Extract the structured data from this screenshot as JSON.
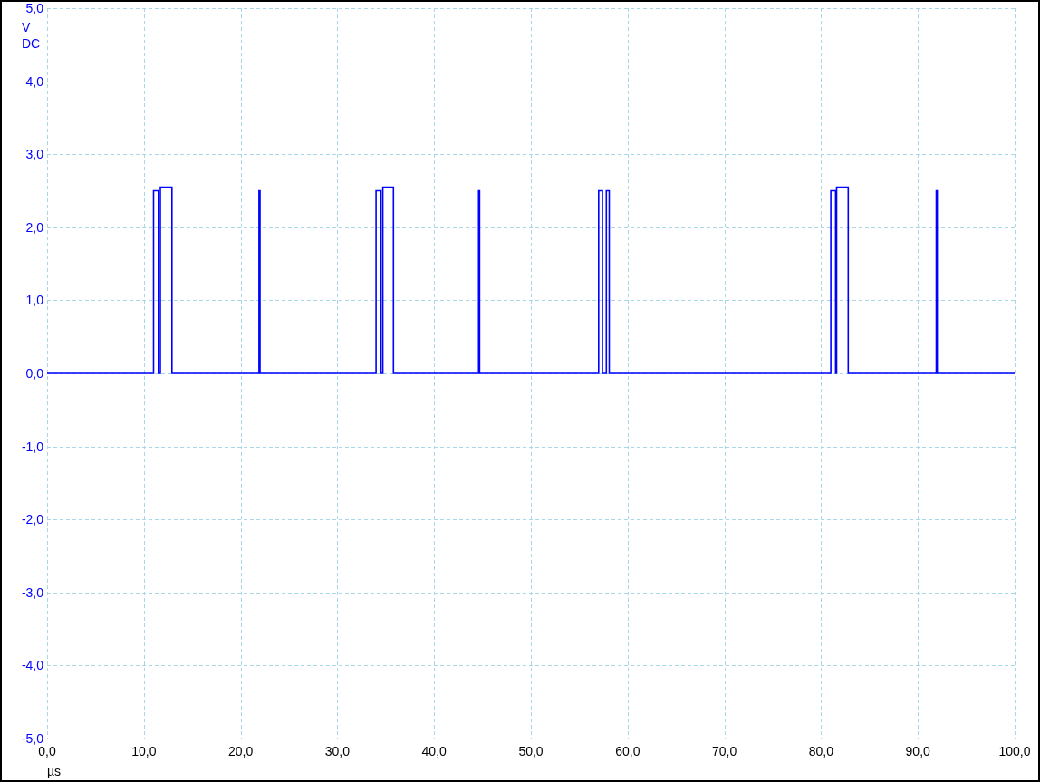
{
  "scope": {
    "coupling": "DC",
    "chart_data": {
      "type": "line",
      "grid": true,
      "xlabel": "µs",
      "ylabel": "V",
      "xlim": [
        0,
        100
      ],
      "ylim": [
        -5,
        5
      ],
      "xticks": [
        {
          "value": 0,
          "label": "0,0"
        },
        {
          "value": 10,
          "label": "10,0"
        },
        {
          "value": 20,
          "label": "20,0"
        },
        {
          "value": 30,
          "label": "30,0"
        },
        {
          "value": 40,
          "label": "40,0"
        },
        {
          "value": 50,
          "label": "50,0"
        },
        {
          "value": 60,
          "label": "60,0"
        },
        {
          "value": 70,
          "label": "70,0"
        },
        {
          "value": 80,
          "label": "80,0"
        },
        {
          "value": 90,
          "label": "90,0"
        },
        {
          "value": 100,
          "label": "100,0"
        }
      ],
      "yticks": [
        {
          "value": 5,
          "label": "5,0"
        },
        {
          "value": 4,
          "label": "4,0"
        },
        {
          "value": 3,
          "label": "3,0"
        },
        {
          "value": 2,
          "label": "2,0"
        },
        {
          "value": 1,
          "label": "1,0"
        },
        {
          "value": 0,
          "label": "0,0"
        },
        {
          "value": -1,
          "label": "-1,0"
        },
        {
          "value": -2,
          "label": "-2,0"
        },
        {
          "value": -3,
          "label": "-3,0"
        },
        {
          "value": -4,
          "label": "-4,0"
        },
        {
          "value": -5,
          "label": "-5,0"
        }
      ],
      "x": [
        0,
        11.0,
        11.0,
        11.5,
        11.5,
        11.7,
        11.7,
        12.9,
        12.9,
        21.9,
        21.9,
        22.0,
        22.0,
        34.0,
        34.0,
        34.5,
        34.5,
        34.7,
        34.7,
        35.8,
        35.8,
        44.6,
        44.6,
        44.7,
        44.7,
        57.0,
        57.0,
        57.4,
        57.4,
        57.8,
        57.8,
        58.1,
        58.1,
        81.0,
        81.0,
        81.5,
        81.5,
        81.6,
        81.6,
        82.8,
        82.8,
        91.9,
        91.9,
        92.0,
        92.0,
        100
      ],
      "series": [
        {
          "color": "#0000ff",
          "values": [
            0,
            0,
            2.5,
            2.5,
            0,
            0,
            2.55,
            2.55,
            0,
            0,
            2.5,
            2.5,
            0,
            0,
            2.5,
            2.5,
            0,
            0,
            2.55,
            2.55,
            0,
            0,
            2.5,
            2.5,
            0,
            0,
            2.5,
            2.5,
            0,
            0,
            2.5,
            2.5,
            0,
            0,
            2.5,
            2.5,
            0,
            0,
            2.55,
            2.55,
            0,
            0,
            2.5,
            2.5,
            0,
            0
          ]
        }
      ]
    }
  }
}
